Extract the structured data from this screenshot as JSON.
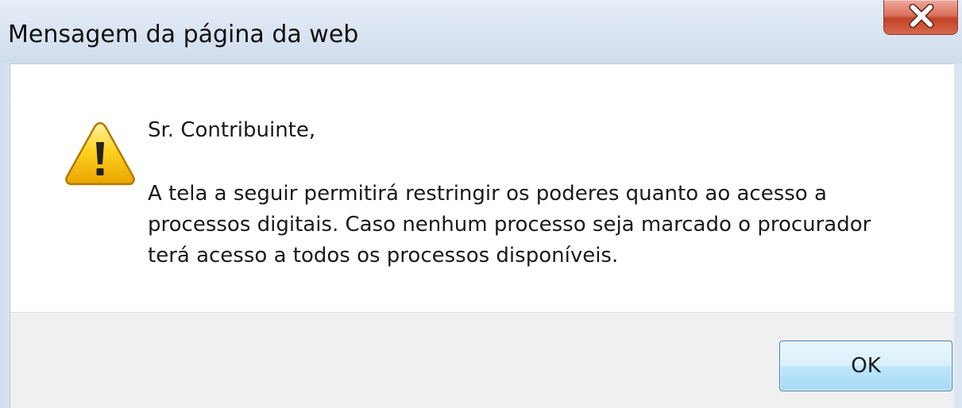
{
  "window": {
    "title": "Mensagem da página da web",
    "close_icon": "close-icon",
    "close_button_color": "#c9462c"
  },
  "message": {
    "icon": "warning-icon",
    "icon_color": "#f5c400",
    "greeting": "Sr. Contribuinte,",
    "lines": [
      "A tela a seguir permitirá restringir os poderes quanto ao acesso a",
      "processos digitais. Caso nenhum processo seja marcado o procurador",
      "terá acesso a todos os processos disponíveis."
    ]
  },
  "buttons": {
    "ok_label": "OK"
  }
}
